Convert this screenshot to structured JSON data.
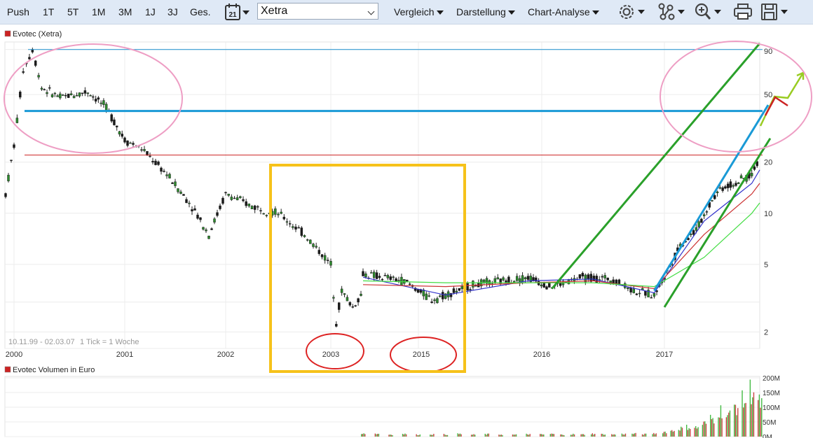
{
  "toolbar": {
    "periods": [
      "Push",
      "1T",
      "5T",
      "1M",
      "3M",
      "1J",
      "3J",
      "Ges."
    ],
    "calendar_day": "21",
    "exchange": "Xetra",
    "menus": [
      "Vergleich",
      "Darstellung",
      "Chart-Analyse"
    ]
  },
  "chart_data": {
    "type": "line",
    "price_panel": {
      "legend": "Evotec (Xetra)",
      "legend_color": "#cc2222",
      "y_scale": "log",
      "ylim": [
        1.6,
        100
      ],
      "y_ticks": [
        90,
        50,
        20,
        10,
        5,
        2
      ],
      "y_tick_labels": [
        "90",
        "50",
        "20",
        "10",
        "5",
        "2"
      ],
      "range_label": "10.11.99 - 02.03.07",
      "tick_label": "1 Tick = 1 Woche",
      "x_ticks": [
        "2000",
        "2001",
        "2002",
        "2003",
        "2015",
        "2016",
        "2017"
      ],
      "series": [
        {
          "style": "candlestick",
          "points": [
            [
              "1999-11",
              13
            ],
            [
              "2000-01",
              25
            ],
            [
              "2000-02",
              70
            ],
            [
              "2000-03",
              92
            ],
            [
              "2000-04",
              55
            ],
            [
              "2000-06",
              48
            ],
            [
              "2000-09",
              52
            ],
            [
              "2000-11",
              42
            ],
            [
              "2001-01",
              27
            ],
            [
              "2001-03",
              24
            ],
            [
              "2001-06",
              17
            ],
            [
              "2001-09",
              11
            ],
            [
              "2001-11",
              7.5
            ],
            [
              "2002-01",
              13
            ],
            [
              "2002-04",
              11
            ],
            [
              "2002-07",
              10
            ],
            [
              "2002-10",
              7.5
            ],
            [
              "2003-01",
              5
            ],
            [
              "2003-03",
              2.3
            ],
            [
              "2003-05",
              3.5
            ],
            [
              "2003-09",
              2.8
            ],
            [
              "2003-12",
              3.3
            ],
            [
              "2014-12",
              4.4
            ],
            [
              "2015-03",
              4
            ],
            [
              "2015-05",
              3.1
            ],
            [
              "2015-08",
              3.8
            ],
            [
              "2015-12",
              4.2
            ],
            [
              "2016-02",
              3.7
            ],
            [
              "2016-05",
              4.2
            ],
            [
              "2016-08",
              4.1
            ],
            [
              "2016-10",
              3.5
            ],
            [
              "2016-12",
              3.3
            ],
            [
              "2017-01",
              4.2
            ],
            [
              "2017-03",
              6.5
            ],
            [
              "2017-05",
              8
            ],
            [
              "2017-07",
              12
            ],
            [
              "2017-08",
              14
            ],
            [
              "2017-10",
              15
            ],
            [
              "2017-12",
              17
            ],
            [
              "2018-01",
              21
            ]
          ]
        }
      ],
      "moving_averages": [
        {
          "color": "#3333cc",
          "points": [
            [
              "2014-12",
              4.2
            ],
            [
              "2015-06",
              3.3
            ],
            [
              "2015-12",
              4.0
            ],
            [
              "2016-06",
              4.1
            ],
            [
              "2016-12",
              3.4
            ],
            [
              "2017-06",
              9
            ],
            [
              "2017-12",
              15
            ],
            [
              "2018-01",
              18
            ]
          ]
        },
        {
          "color": "#cc3333",
          "points": [
            [
              "2014-12",
              3.8
            ],
            [
              "2015-06",
              3.7
            ],
            [
              "2015-12",
              3.9
            ],
            [
              "2016-06",
              4.0
            ],
            [
              "2016-12",
              3.6
            ],
            [
              "2017-06",
              7.5
            ],
            [
              "2017-12",
              13
            ],
            [
              "2018-01",
              15
            ]
          ]
        },
        {
          "color": "#44dd44",
          "points": [
            [
              "2014-12",
              4.0
            ],
            [
              "2015-06",
              3.9
            ],
            [
              "2015-12",
              3.9
            ],
            [
              "2016-06",
              3.9
            ],
            [
              "2016-12",
              3.7
            ],
            [
              "2017-06",
              5.5
            ],
            [
              "2017-12",
              10
            ],
            [
              "2018-01",
              11.5
            ]
          ]
        }
      ],
      "annotations": {
        "hlines": [
          {
            "value": 92,
            "color": "#1a8fcf",
            "width": 1
          },
          {
            "value": 40,
            "color": "#1a9ad6",
            "width": 3
          },
          {
            "value": 22,
            "color": "#cc2222",
            "width": 1
          }
        ],
        "trend_lines": [
          {
            "color": "#2aa02a",
            "from": [
              "2016-02",
              3.6
            ],
            "to": [
              "2018-01",
              100
            ]
          },
          {
            "color": "#2aa02a",
            "from": [
              "2017-01",
              2.8
            ],
            "to": [
              "2018-01",
              22
            ]
          },
          {
            "color": "#1a9ad6",
            "from": [
              "2016-12",
              3.5
            ],
            "to": [
              "2018-01",
              36
            ]
          }
        ],
        "arrows": [
          {
            "color": "#99cc22",
            "from": [
              "2018-01",
              21
            ],
            "to": [
              "2018-01",
              60
            ]
          },
          {
            "color": "#cc2222",
            "from": [
              "2018-01",
              35
            ],
            "to": [
              "2018-01",
              46
            ]
          }
        ],
        "ellipses": [
          {
            "color": "#ee9ec4",
            "role": "top-left"
          },
          {
            "color": "#ee9ec4",
            "role": "top-right"
          },
          {
            "color": "#dd2222",
            "role": "x-label-2003"
          },
          {
            "color": "#dd2222",
            "role": "x-label-2015"
          }
        ],
        "rectangle": {
          "color": "#f6c21a"
        }
      }
    },
    "volume_panel": {
      "legend": "Evotec Volumen in Euro",
      "legend_color": "#cc2222",
      "ylim": [
        0,
        200
      ],
      "y_ticks": [
        200,
        150,
        100,
        50,
        0
      ],
      "y_tick_labels": [
        "200M",
        "150M",
        "100M",
        "50M",
        "0M"
      ],
      "bars": [
        [
          "2014-12",
          14
        ],
        [
          "2015-01",
          12
        ],
        [
          "2015-02",
          9
        ],
        [
          "2015-03",
          11
        ],
        [
          "2015-04",
          8
        ],
        [
          "2015-05",
          10
        ],
        [
          "2015-06",
          9
        ],
        [
          "2015-07",
          11
        ],
        [
          "2015-08",
          8
        ],
        [
          "2015-09",
          10
        ],
        [
          "2015-10",
          9
        ],
        [
          "2015-11",
          8
        ],
        [
          "2015-12",
          10
        ],
        [
          "2016-01",
          9
        ],
        [
          "2016-02",
          11
        ],
        [
          "2016-03",
          8
        ],
        [
          "2016-04",
          10
        ],
        [
          "2016-05",
          9
        ],
        [
          "2016-06",
          12
        ],
        [
          "2016-07",
          10
        ],
        [
          "2016-08",
          9
        ],
        [
          "2016-09",
          11
        ],
        [
          "2016-10",
          12
        ],
        [
          "2016-11",
          10
        ],
        [
          "2016-12",
          13
        ],
        [
          "2017-01",
          20
        ],
        [
          "2017-02",
          25
        ],
        [
          "2017-03",
          35
        ],
        [
          "2017-04",
          40
        ],
        [
          "2017-05",
          38
        ],
        [
          "2017-06",
          55
        ],
        [
          "2017-07",
          75
        ],
        [
          "2017-08",
          110
        ],
        [
          "2017-09",
          90
        ],
        [
          "2017-10",
          130
        ],
        [
          "2017-11",
          150
        ],
        [
          "2017-12",
          195
        ],
        [
          "2018-01",
          140
        ]
      ]
    }
  }
}
